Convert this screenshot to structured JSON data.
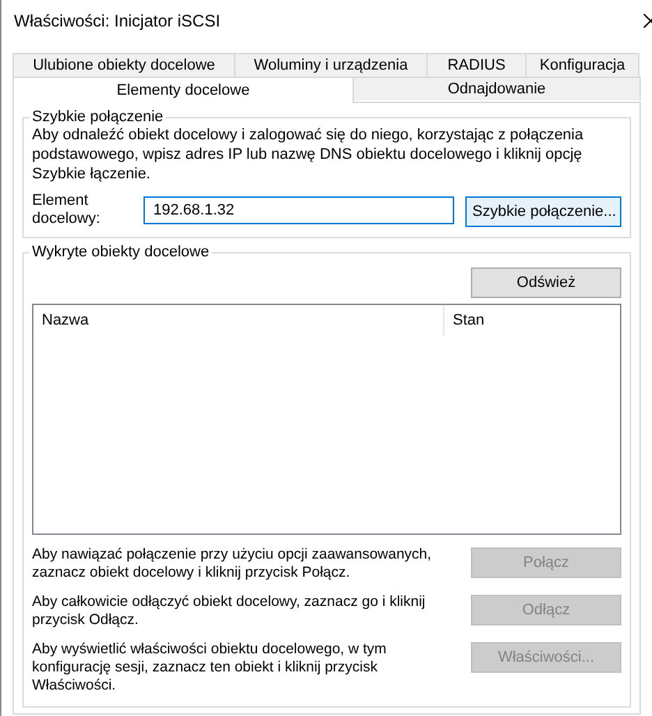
{
  "window": {
    "title": "Właściwości: Inicjator iSCSI"
  },
  "tab_rows": [
    {
      "tabs": [
        {
          "label": "Ulubione obiekty docelowe",
          "selected": false
        },
        {
          "label": "Woluminy i urządzenia",
          "selected": false
        },
        {
          "label": "RADIUS",
          "selected": false
        },
        {
          "label": "Konfiguracja",
          "selected": false
        }
      ]
    },
    {
      "tabs": [
        {
          "label": "Elementy docelowe",
          "selected": true
        },
        {
          "label": "Odnajdowanie",
          "selected": false
        }
      ]
    }
  ],
  "quick_connect": {
    "title": "Szybkie połączenie",
    "description": "Aby odnaleźć obiekt docelowy i zalogować się do niego, korzystając z połączenia podstawowego, wpisz adres IP lub nazwę DNS obiektu docelowego i kliknij opcję Szybkie łączenie.",
    "target_label": "Element docelowy:",
    "target_value": "192.68.1.32",
    "button": {
      "label": "Szybkie połączenie...",
      "disabled": false
    }
  },
  "discovered": {
    "title": "Wykryte obiekty docelowe",
    "refresh_button": {
      "label": "Odśwież",
      "disabled": false
    },
    "table": {
      "columns": [
        "Nazwa",
        "Stan"
      ]
    },
    "actions": [
      {
        "text": "Aby nawiązać połączenie przy użyciu opcji zaawansowanych, zaznacz obiekt docelowy i kliknij przycisk Połącz.",
        "button": {
          "label": "Połącz",
          "disabled": true
        }
      },
      {
        "text": "Aby całkowicie odłączyć obiekt docelowy, zaznacz go i kliknij przycisk Odłącz.",
        "button": {
          "label": "Odłącz",
          "disabled": true
        }
      },
      {
        "text": "Aby wyświetlić właściwości obiektu docelowego, w tym konfigurację sesji, zaznacz ten obiekt i kliknij przycisk Właściwości.",
        "button": {
          "label": "Właściwości...",
          "disabled": true
        }
      }
    ]
  }
}
